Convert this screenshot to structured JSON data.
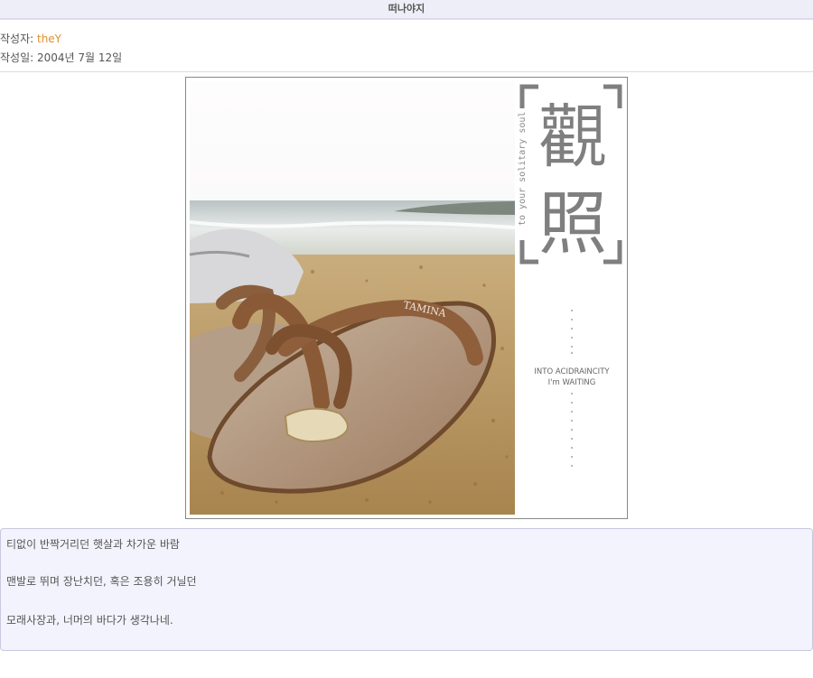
{
  "post": {
    "title": "떠나야지",
    "author_label": "작성자: ",
    "author_name": "theY",
    "date_label": "작성일: ",
    "date_value": "2004년 7월 12일"
  },
  "image": {
    "vertical_caption": "to your solitary soul",
    "chars_top": "觀",
    "chars_bottom": "照",
    "into_line": "INTO ACIDRAINCITY",
    "waiting_line": "I'm WAITING",
    "sandal_brand": "TAMINA"
  },
  "body": {
    "lines": [
      "티없이 반짝거리던 햇살과 차가운 바람",
      "맨발로 뛰며 장난치던, 혹은 조용히 거닐던",
      "모래사장과, 너머의 바다가 생각나네."
    ]
  },
  "colors": {
    "accent": "#e0902a",
    "title_bg": "#eeeef8",
    "box_bg": "#f3f3fd"
  }
}
